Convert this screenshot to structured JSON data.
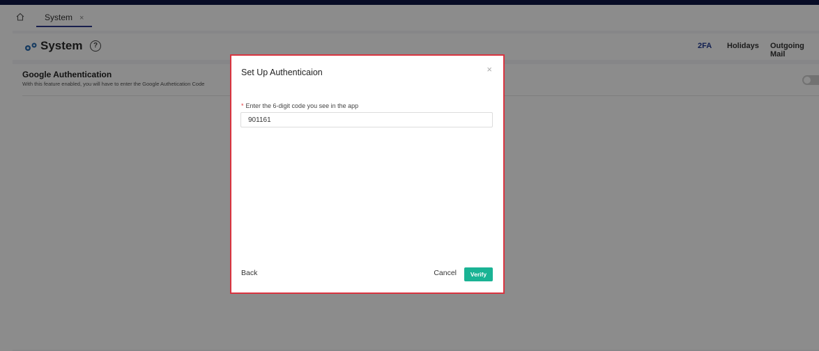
{
  "tabs": {
    "home_icon": "home-icon",
    "items": [
      {
        "label": "System",
        "close": "×"
      }
    ]
  },
  "header": {
    "icon": "gear-icon",
    "title": "System",
    "help_icon": "help-icon",
    "help_symbol": "?",
    "nav": [
      {
        "label": "2FA",
        "active": true
      },
      {
        "label": "Holidays",
        "active": false
      },
      {
        "label": "Outgoing Mail",
        "active": false
      }
    ]
  },
  "section": {
    "title": "Google Authentication",
    "description": "With this feature enabled, you will have to enter the Google Authetication Code",
    "toggle_on": false
  },
  "modal": {
    "title": "Set Up Authenticaion",
    "close": "×",
    "required_mark": "*",
    "field_label": "Enter the 6-digit code you see in the app",
    "field_value": "901161",
    "back_label": "Back",
    "cancel_label": "Cancel",
    "verify_label": "Verify"
  },
  "colors": {
    "accent": "#1ab394",
    "active_nav": "#1f3a93",
    "modal_border": "#d9333f"
  }
}
